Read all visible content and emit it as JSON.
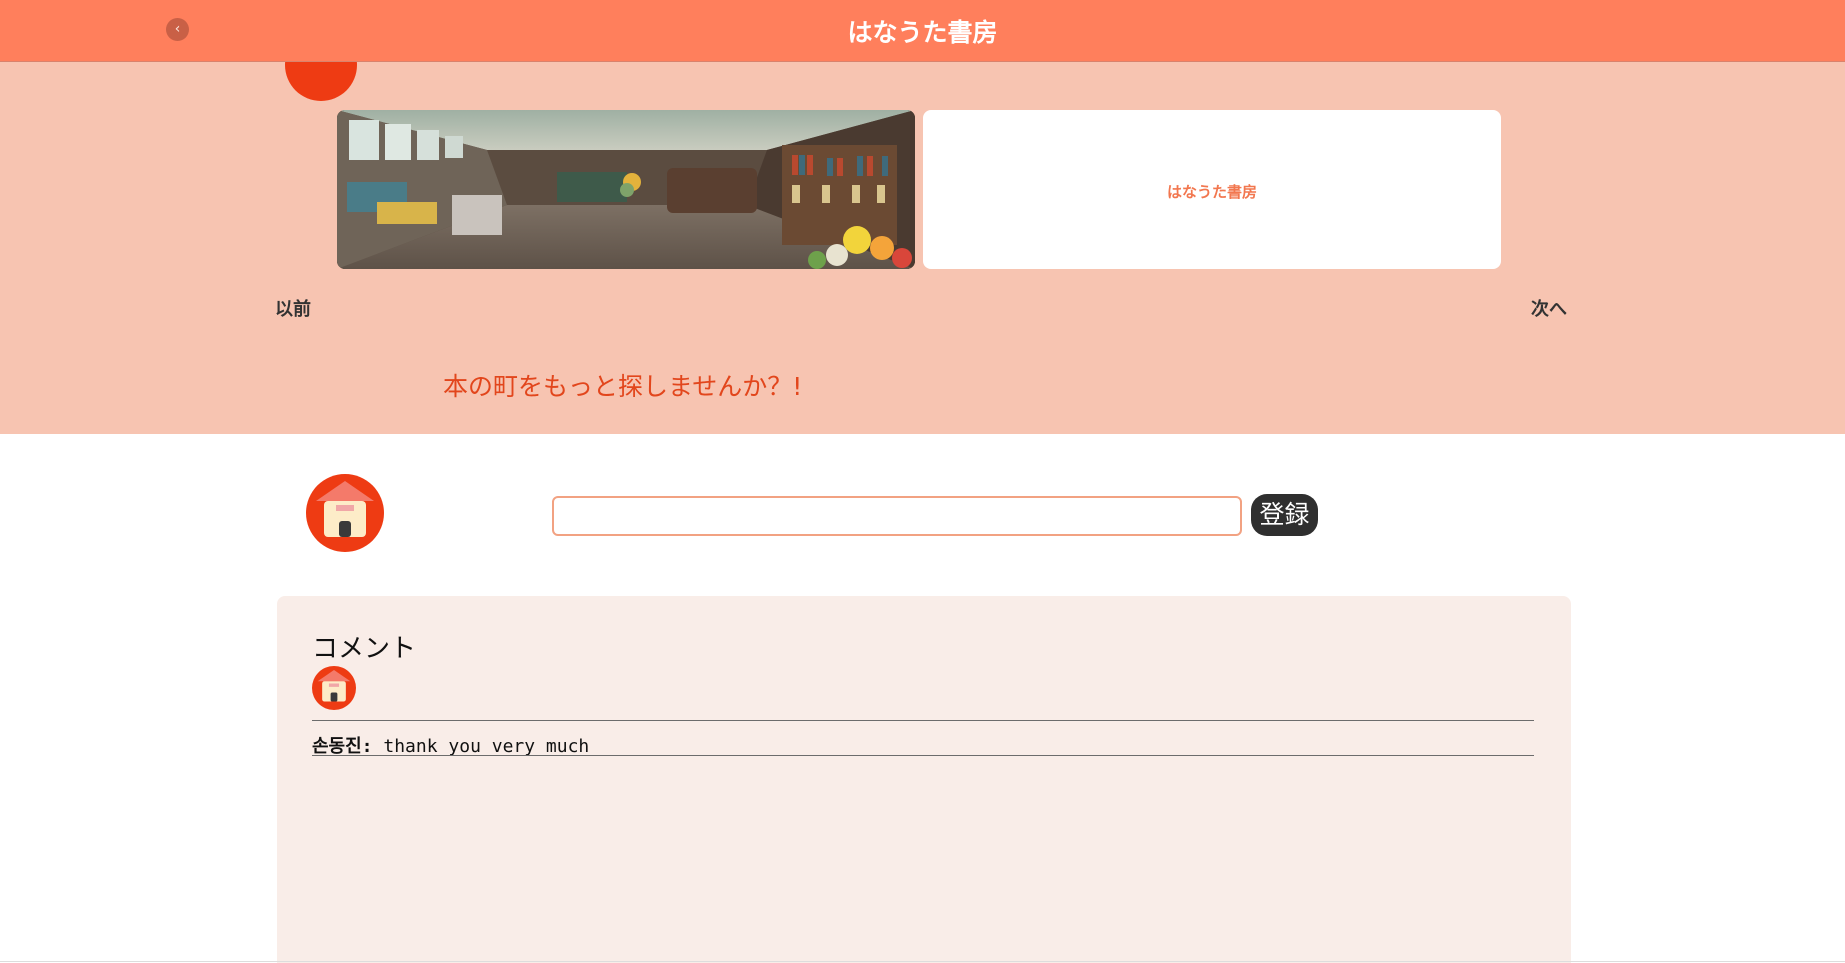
{
  "header": {
    "title": "はなうた書房",
    "back_icon": "chevron-left-icon",
    "back_glyph": "‹",
    "bg_color": "#ff7f5c"
  },
  "carousel": {
    "slides": [
      {
        "type": "photo"
      },
      {
        "type": "card",
        "label": "はなうた書房"
      }
    ],
    "prev_label": "以前",
    "next_label": "次へ",
    "bg_color": "#f7c4b1"
  },
  "hero": {
    "cta": "本の町をもっと探しませんか？!"
  },
  "comment_form": {
    "input_value": "",
    "input_placeholder": "",
    "submit_label": "登録"
  },
  "comments": {
    "heading": "コメント",
    "items": [
      {
        "author": "손동진:",
        "text": " thank you very much"
      }
    ]
  },
  "colors": {
    "accent": "#ff7f5c",
    "avatar_red": "#ee3b13",
    "cta_text": "#e2461c",
    "panel_bg": "#f9ede8"
  }
}
